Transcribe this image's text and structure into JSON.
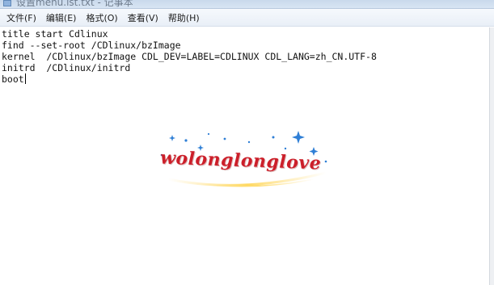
{
  "window": {
    "title": "设置menu.lst.txt - 记事本"
  },
  "menubar": {
    "items": [
      {
        "label": "文件(F)"
      },
      {
        "label": "编辑(E)"
      },
      {
        "label": "格式(O)"
      },
      {
        "label": "查看(V)"
      },
      {
        "label": "帮助(H)"
      }
    ]
  },
  "editor": {
    "lines": [
      "title start Cdlinux",
      "find --set-root /CDlinux/bzImage",
      "kernel  /CDlinux/bzImage CDL_DEV=LABEL=CDLINUX CDL_LANG=zh_CN.UTF-8",
      "initrd  /CDlinux/initrd",
      "boot"
    ]
  },
  "watermark": {
    "text": "wolonglonglove",
    "color": "#cc1f2a"
  },
  "colors": {
    "menubar_bg": "#eef3f9",
    "editor_bg": "#ffffff",
    "watermark_red": "#cc1f2a",
    "sparkle_blue": "#2f7fd6"
  }
}
